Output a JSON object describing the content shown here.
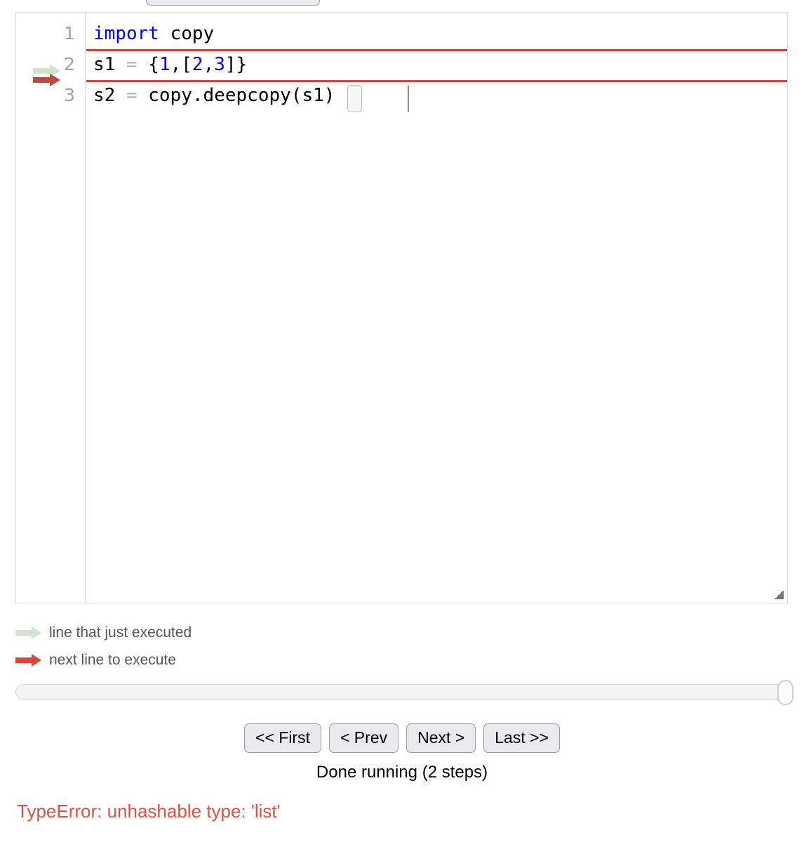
{
  "editor": {
    "language": "python",
    "line_numbers": [
      "1",
      "2",
      "3"
    ],
    "lines": [
      {
        "number": "1",
        "text": "import copy"
      },
      {
        "number": "2",
        "text": "s1 = {1,[2,3]}"
      },
      {
        "number": "3",
        "text": "s2 = copy.deepcopy(s1)"
      }
    ],
    "line1_keyword": "import",
    "line1_rest": " copy",
    "line2_var": "s1",
    "line2_eq": "=",
    "line2_open": "{",
    "line2_n1": "1",
    "line2_comma1": ",",
    "line2_lbracket": "[",
    "line2_n2": "2",
    "line2_comma2": ",",
    "line2_n3": "3",
    "line2_rbracket": "]",
    "line2_close": "}",
    "line3_var": "s2",
    "line3_eq": "=",
    "line3_call": "copy.deepcopy",
    "line3_lparen": "(",
    "line3_arg": "s1",
    "line3_rparen": ")",
    "highlighted_line": "2",
    "resize_handle_name": "resize-handle"
  },
  "legend": {
    "items": [
      {
        "label": "line that just executed",
        "color": "#cfe3cd"
      },
      {
        "label": "next line to execute",
        "color": "#d9453a"
      }
    ]
  },
  "slider": {
    "name": "execution-step-slider",
    "value": "2",
    "min": "1",
    "max": "2",
    "position_percent": "100"
  },
  "navigation": {
    "first_label": "<< First",
    "prev_label": "< Prev",
    "next_label": "Next >",
    "last_label": "Last >>"
  },
  "status": {
    "text": "Done running (2 steps)",
    "steps": "2"
  },
  "error": {
    "text": "TypeError: unhashable type: 'list'",
    "color": "#e05243"
  },
  "colors": {
    "keyword": "#0000ee",
    "number": "#0000ee",
    "operator": "#a9b3bd",
    "highlight_line": "#cc4433",
    "arrow_executed": "#cfe3cd",
    "arrow_next": "#d9453a",
    "button_bg": "#e9e9ee",
    "button_border": "#9a9aa6"
  }
}
